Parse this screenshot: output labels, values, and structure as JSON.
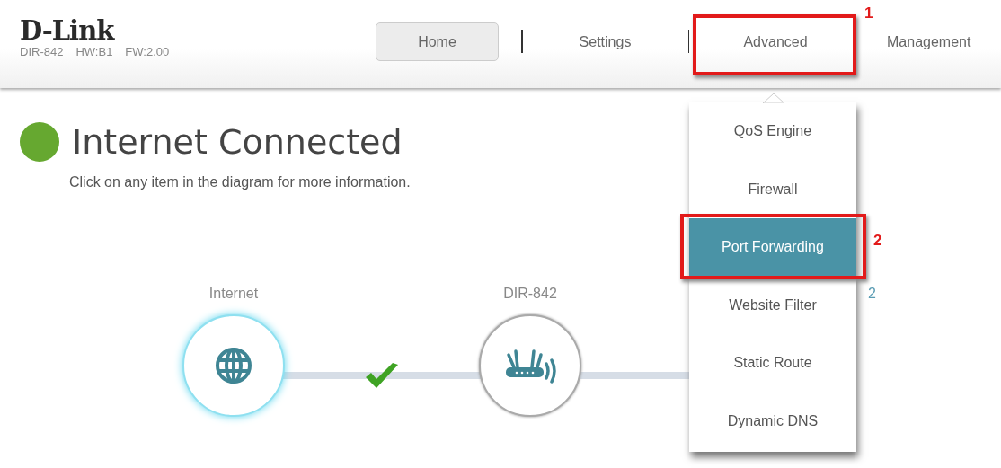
{
  "header": {
    "logo": "D-Link",
    "model": "DIR-842",
    "hardware": "HW:B1",
    "firmware": "FW:2.00"
  },
  "nav": [
    {
      "label": "Home",
      "selected": true
    },
    {
      "label": "Settings",
      "selected": false
    },
    {
      "label": "Advanced",
      "selected": false
    },
    {
      "label": "Management",
      "selected": false
    }
  ],
  "status": {
    "title": "Internet Connected",
    "color": "#66a830",
    "subtitle": "Click on any item in the diagram for more information."
  },
  "diagram": {
    "nodes": [
      {
        "kind": "internet",
        "label": "Internet"
      },
      {
        "kind": "router",
        "label": "DIR-842"
      }
    ],
    "link_ok": true,
    "partial_text": "2"
  },
  "dropdown": {
    "items": [
      {
        "label": "QoS Engine",
        "selected": false
      },
      {
        "label": "Firewall",
        "selected": false
      },
      {
        "label": "Port Forwarding",
        "selected": true
      },
      {
        "label": "Website Filter",
        "selected": false
      },
      {
        "label": "Static Route",
        "selected": false
      },
      {
        "label": "Dynamic DNS",
        "selected": false
      }
    ]
  },
  "annotations": [
    {
      "label": "1"
    },
    {
      "label": "2"
    }
  ]
}
